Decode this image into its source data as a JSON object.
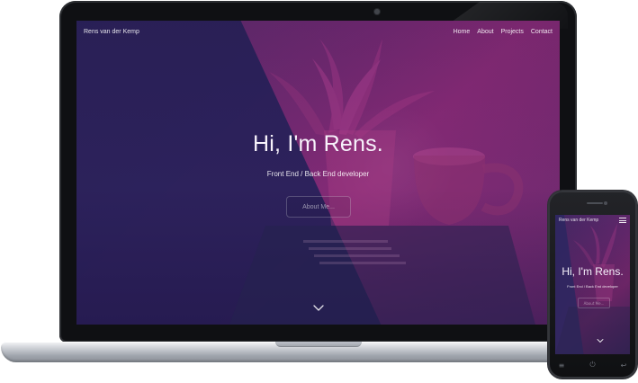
{
  "desktop": {
    "brand": "Rens van der Kemp",
    "nav_items": [
      "Home",
      "About",
      "Projects",
      "Contact"
    ],
    "hero_title": "Hi, I'm Rens.",
    "hero_subtitle": "Front End / Back End developer",
    "hero_button": "About Me..."
  },
  "mobile": {
    "brand": "Rens van der Kemp",
    "hero_title": "Hi, I'm Rens.",
    "hero_subtitle": "Front End / Back End developer",
    "hero_button": "About Me..."
  },
  "colors": {
    "screen_purple": "#7a2b77",
    "screen_dark": "#2c235e",
    "device_black": "#0f1013",
    "silver": "#c9ccd2"
  },
  "icons": {
    "scroll": "chevron-down-icon",
    "menu": "hamburger-menu-icon",
    "back": "back-icon",
    "home": "power-icon",
    "recent": "recent-apps-icon"
  }
}
